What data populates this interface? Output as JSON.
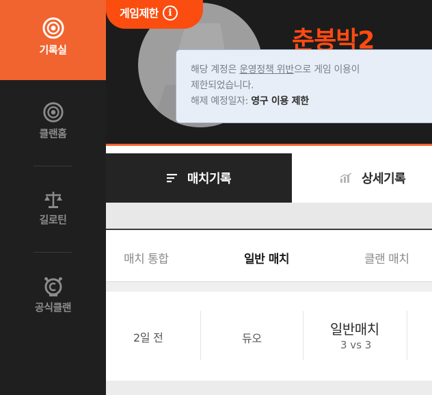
{
  "sidebar": {
    "items": [
      {
        "label": "기록실",
        "icon": "target-icon",
        "active": true
      },
      {
        "label": "클랜홈",
        "icon": "target-icon",
        "active": false
      },
      {
        "label": "길로틴",
        "icon": "scale-icon",
        "active": false
      },
      {
        "label": "공식클랜",
        "icon": "clan-crest-icon",
        "active": false
      }
    ]
  },
  "header": {
    "restriction_badge": "게임제한",
    "player_name": "춘봉박2",
    "tooltip": {
      "line1_prefix": "해당 계정은 ",
      "line1_link": "운영정책 위반",
      "line1_suffix": "으로 게임 이용이",
      "line2": "제한되었습니다.",
      "line3_prefix": "해제 예정일자: ",
      "line3_value": "영구 이용 제한"
    }
  },
  "tabs": {
    "main": [
      {
        "label": "매치기록",
        "icon": "list-icon",
        "active": true
      },
      {
        "label": "상세기록",
        "icon": "bar-chart-icon",
        "active": false
      }
    ],
    "sub": [
      {
        "label": "매치 통합",
        "active": false
      },
      {
        "label": "일반 매치",
        "active": true
      },
      {
        "label": "클랜 매치",
        "active": false
      }
    ]
  },
  "match": {
    "time_ago": "2일 전",
    "mode": "듀오",
    "match_type": "일반매치",
    "team_format": "3 vs 3"
  },
  "colors": {
    "accent": "#f1642f",
    "badge": "#fb4d0f",
    "name": "#ff4a12",
    "sidebar_bg": "#1f1f1f"
  }
}
